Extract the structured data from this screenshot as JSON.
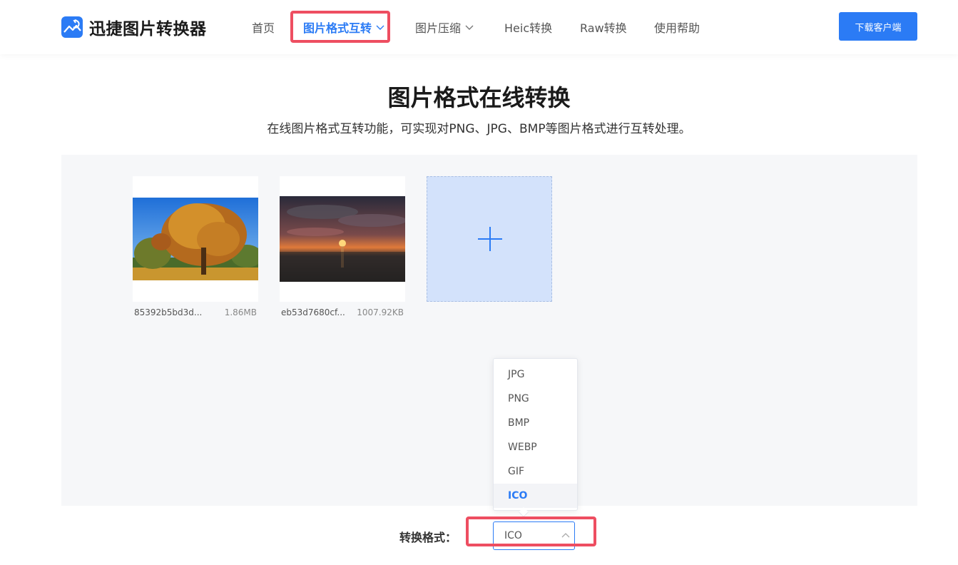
{
  "header": {
    "brand_name": "迅捷图片转换器",
    "nav": [
      {
        "label": "首页",
        "active": false,
        "has_dropdown": false
      },
      {
        "label": "图片格式互转",
        "active": true,
        "has_dropdown": true
      },
      {
        "label": "图片压缩",
        "active": false,
        "has_dropdown": true
      },
      {
        "label": "Heic转换",
        "active": false,
        "has_dropdown": false
      },
      {
        "label": "Raw转换",
        "active": false,
        "has_dropdown": false
      },
      {
        "label": "使用帮助",
        "active": false,
        "has_dropdown": false
      }
    ],
    "download_label": "下载客户端"
  },
  "hero": {
    "title": "图片格式在线转换",
    "subtitle": "在线图片格式互转功能，可实现对PNG、JPG、BMP等图片格式进行互转处理。"
  },
  "files": [
    {
      "name": "85392b5bd3d...",
      "size": "1.86MB",
      "thumbnail": "autumn-tree-photo"
    },
    {
      "name": "eb53d7680cf...",
      "size": "1007.92KB",
      "thumbnail": "sunset-sea-photo"
    }
  ],
  "add_icon": "plus-icon",
  "format": {
    "label": "转换格式：",
    "selected": "ICO",
    "options": [
      "JPG",
      "PNG",
      "BMP",
      "WEBP",
      "GIF",
      "ICO"
    ]
  },
  "colors": {
    "accent": "#2b7bf5",
    "highlight": "#ee4e61",
    "panel_bg": "#f6f7f9",
    "add_box_bg": "#d3e2fb"
  }
}
